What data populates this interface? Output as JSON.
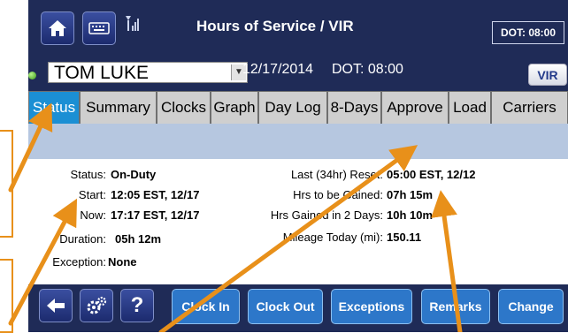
{
  "header": {
    "title": "Hours of Service / VIR",
    "dot_box": "DOT: 08:00",
    "icons": [
      "home-icon",
      "keyboard-icon",
      "signal-icon"
    ]
  },
  "driver": {
    "name": "TOM LUKE",
    "date": "12/17/2014",
    "dot": "DOT: 08:00",
    "vir_label": "VIR",
    "status_led_color": "#3a9a16"
  },
  "tabs": [
    {
      "label": "Status",
      "active": true
    },
    {
      "label": "Summary"
    },
    {
      "label": "Clocks"
    },
    {
      "label": "Graph"
    },
    {
      "label": "Day Log"
    },
    {
      "label": "8-Days"
    },
    {
      "label": "Approve"
    },
    {
      "label": "Load"
    },
    {
      "label": "Carriers"
    }
  ],
  "status_panel": {
    "left": [
      {
        "label": "Status:",
        "value": "On-Duty"
      },
      {
        "label": "Start:",
        "value": "12:05 EST, 12/17"
      },
      {
        "label": "Now:",
        "value": "17:17 EST, 12/17"
      },
      {
        "label": "Duration:",
        "value": "05h 12m"
      },
      {
        "label": "Exception:",
        "value": "None"
      }
    ],
    "right": [
      {
        "label": "Last (34hr) Reset:",
        "value": "05:00 EST, 12/12"
      },
      {
        "label": "Hrs to be Gained:",
        "value": "07h 15m"
      },
      {
        "label": "Hrs Gained in 2 Days:",
        "value": "10h 10m"
      },
      {
        "label": "Mileage Today (mi):",
        "value": "150.11"
      }
    ]
  },
  "bottom": {
    "nav_icons": [
      "back-arrow-icon",
      "gears-icon",
      "help-icon"
    ],
    "help_label": "?",
    "buttons": [
      "Clock In",
      "Clock Out",
      "Exceptions",
      "Remarks",
      "Change"
    ]
  },
  "colors": {
    "screen_bg": "#1f2b57",
    "active_tab": "#1b8fd4",
    "action_button": "#2d77c9",
    "annotation": "#e8901a"
  }
}
